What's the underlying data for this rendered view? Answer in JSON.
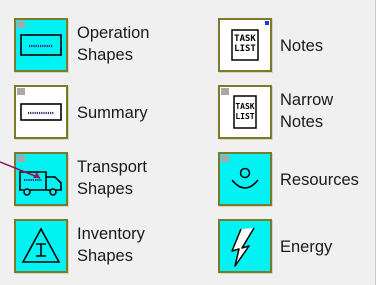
{
  "palette": {
    "items": [
      {
        "id": "operation-shapes",
        "label_line1": "Operation",
        "label_line2": "Shapes",
        "icon": "operation-box-icon",
        "tile_color": "#00f2f2"
      },
      {
        "id": "summary",
        "label_line1": "Summary",
        "icon": "summary-box-icon",
        "tile_color": "#ffffff"
      },
      {
        "id": "transport-shapes",
        "label_line1": "Transport",
        "label_line2": "Shapes",
        "icon": "truck-icon",
        "tile_color": "#00f2f2"
      },
      {
        "id": "inventory-shapes",
        "label_line1": "Inventory",
        "label_line2": "Shapes",
        "icon": "inventory-triangle-icon",
        "tile_color": "#00f2f2"
      },
      {
        "id": "notes",
        "label_line1": "Notes",
        "icon": "task-list-icon",
        "icon_text_line1": "TASK",
        "icon_text_line2": "LIST",
        "tile_color": "#ffffff"
      },
      {
        "id": "narrow-notes",
        "label_line1": "Narrow",
        "label_line2": "Notes",
        "icon": "task-list-narrow-icon",
        "icon_text_line1": "TASK",
        "icon_text_line2": "LIST",
        "tile_color": "#ffffff"
      },
      {
        "id": "resources",
        "label_line1": "Resources",
        "icon": "resource-operator-icon",
        "tile_color": "#00f2f2"
      },
      {
        "id": "energy",
        "label_line1": "Energy",
        "icon": "lightning-icon",
        "tile_color": "#00f2f2"
      }
    ]
  },
  "colors": {
    "tile_cyan": "#00f2f2",
    "tile_border": "#7a7a28",
    "pointer_arrow": "#8b1a5c"
  }
}
